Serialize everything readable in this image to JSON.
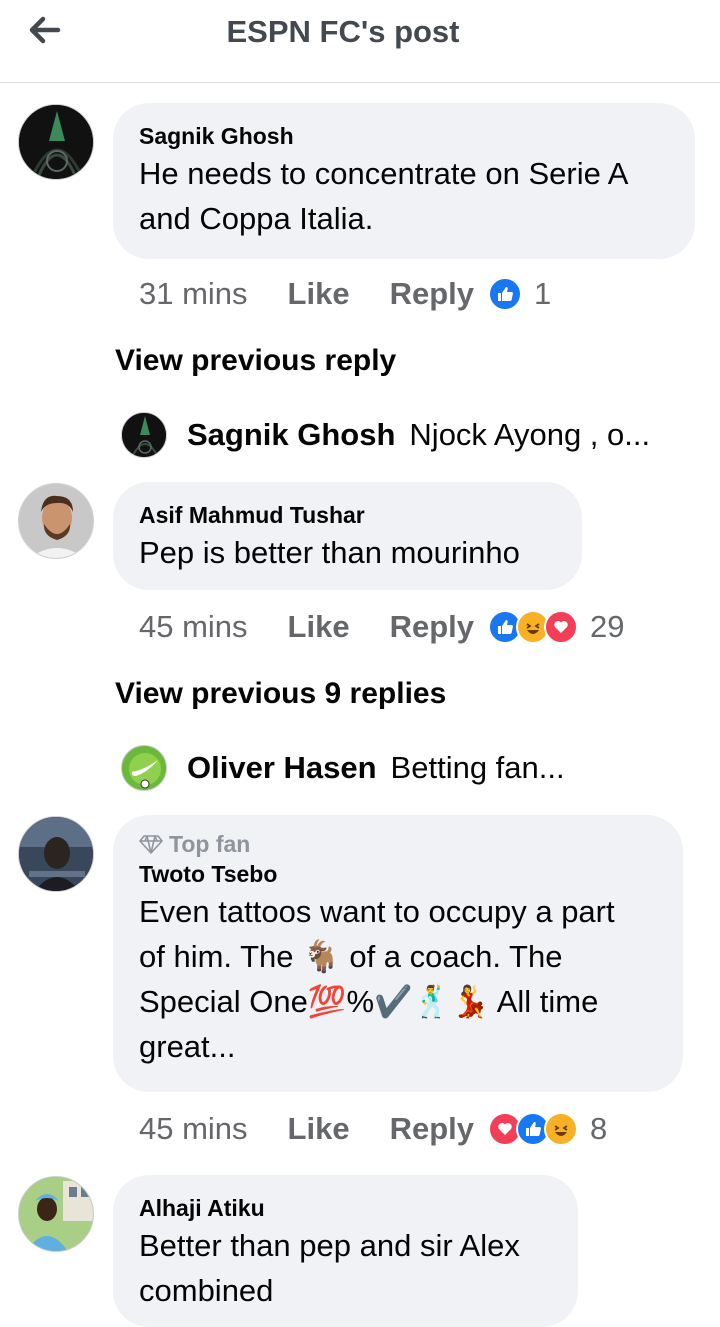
{
  "header": {
    "title": "ESPN FC's post",
    "back_icon": "arrow-left-icon"
  },
  "comments": [
    {
      "name": "Sagnik Ghosh",
      "text_lines": [
        "He needs to concentrate on Serie A",
        "and Coppa Italia."
      ],
      "time": "31 mins",
      "like": "Like",
      "reply": "Reply",
      "reactions": [
        "like"
      ],
      "reaction_count": "1"
    },
    {
      "name": "Asif Mahmud Tushar",
      "text_lines": [
        "Pep is better than mourinho"
      ],
      "time": "45 mins",
      "like": "Like",
      "reply": "Reply",
      "reactions": [
        "like",
        "haha",
        "love"
      ],
      "reaction_count": "29"
    },
    {
      "badge": "Top fan",
      "name": "Twoto Tsebo",
      "text_lines": [
        "Even tattoos want to occupy a part",
        "of him. The 🐐 of a coach. The",
        "Special One💯%✔️🕺💃 All time",
        "great..."
      ],
      "time": "45 mins",
      "like": "Like",
      "reply": "Reply",
      "reactions": [
        "love",
        "like",
        "haha"
      ],
      "reaction_count": "8"
    },
    {
      "name": "Alhaji Atiku",
      "text_lines": [
        "Better than pep and sir Alex",
        "combined"
      ]
    }
  ],
  "replies": [
    {
      "view_previous": "View previous reply",
      "name": "Sagnik Ghosh",
      "text": "Njock Ayong , o..."
    },
    {
      "view_previous": "View previous 9 replies",
      "name": "Oliver Hasen",
      "text": "Betting fan..."
    }
  ],
  "colors": {
    "bubble": "#f0f2f5",
    "like": "#1877f2",
    "love": "#f33e58",
    "haha": "#f7b125",
    "meta": "#65676b"
  }
}
